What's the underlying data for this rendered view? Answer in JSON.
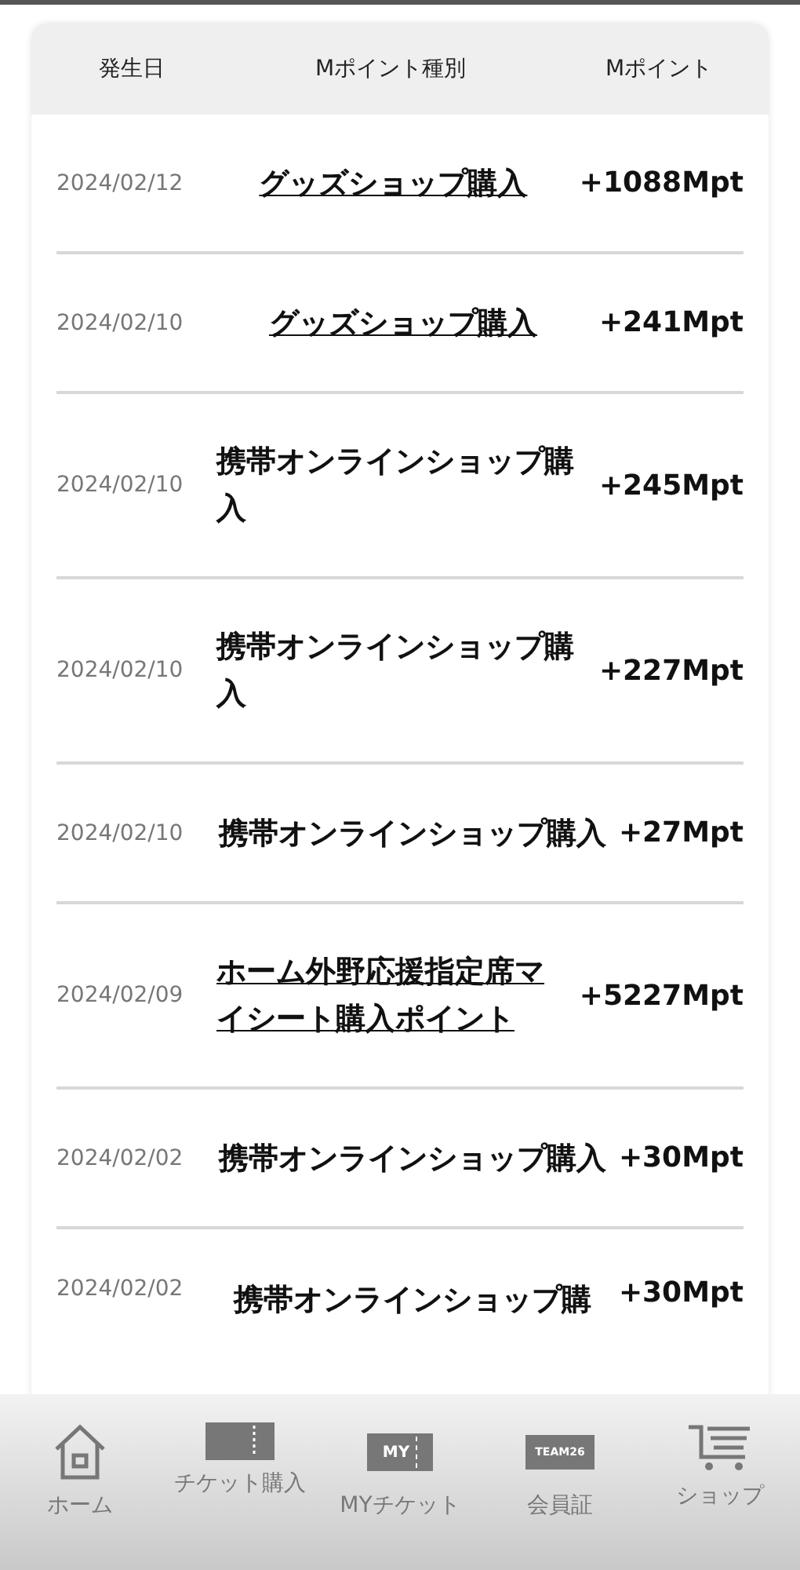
{
  "table": {
    "columns": [
      "発生日",
      "Mポイント種別",
      "Mポイント"
    ],
    "rows": [
      {
        "date": "2024/02/12",
        "type": "グッズショップ購入",
        "link": true,
        "points": "+1088Mpt"
      },
      {
        "date": "2024/02/10",
        "type": "グッズショップ購入",
        "link": true,
        "points": "+241Mpt"
      },
      {
        "date": "2024/02/10",
        "type": "携帯オンラインショップ購入",
        "link": false,
        "points": "+245Mpt"
      },
      {
        "date": "2024/02/10",
        "type": "携帯オンラインショップ購入",
        "link": false,
        "points": "+227Mpt"
      },
      {
        "date": "2024/02/10",
        "type": "携帯オンラインショップ購入",
        "link": false,
        "points": "+27Mpt"
      },
      {
        "date": "2024/02/09",
        "type": "ホーム外野応援指定席マイシート購入ポイント",
        "link": true,
        "points": "+5227Mpt"
      },
      {
        "date": "2024/02/02",
        "type": "携帯オンラインショップ購入",
        "link": false,
        "points": "+30Mpt"
      },
      {
        "date": "2024/02/02",
        "type": "携帯オンラインショップ購",
        "link": false,
        "points": "+30Mpt"
      }
    ]
  },
  "tab_bar": [
    {
      "kind": "home",
      "label": "ホーム"
    },
    {
      "kind": "ticket",
      "label": "チケット購入"
    },
    {
      "kind": "myticket",
      "label": "MYチケット",
      "icon_text": "MY"
    },
    {
      "kind": "card",
      "label": "会員証",
      "icon_text": "TEAM26"
    },
    {
      "kind": "cart",
      "label": "ショップ"
    }
  ]
}
